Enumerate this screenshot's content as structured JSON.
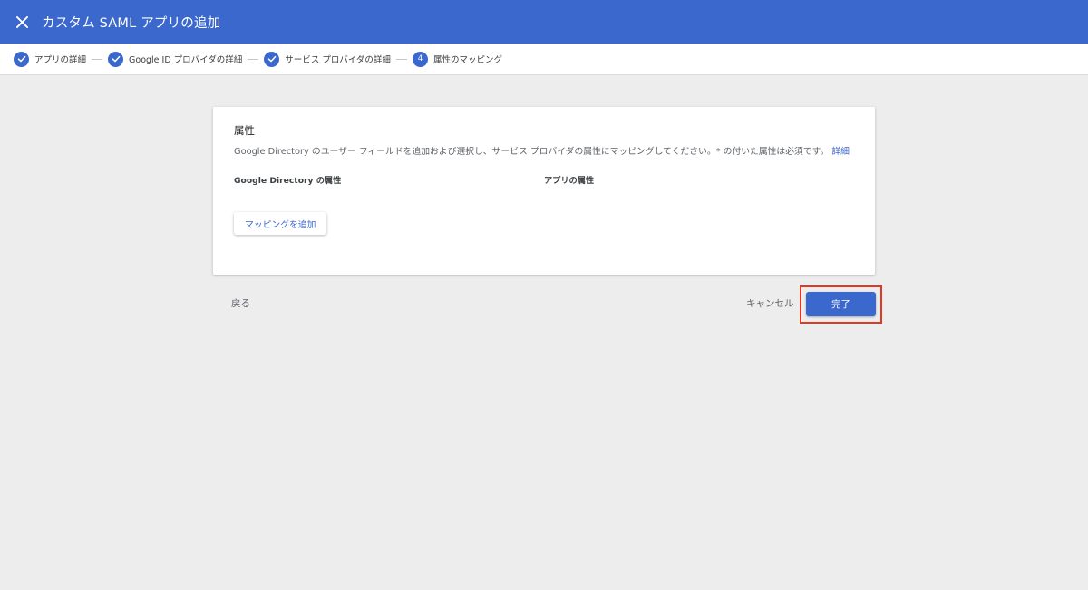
{
  "appbar": {
    "title": "カスタム SAML アプリの追加",
    "close_icon": "close-icon"
  },
  "stepper": {
    "steps": [
      {
        "label": "アプリの詳細",
        "state": "done",
        "icon": "check-icon"
      },
      {
        "label": "Google ID プロバイダの詳細",
        "state": "done",
        "icon": "check-icon"
      },
      {
        "label": "サービス プロバイダの詳細",
        "state": "done",
        "icon": "check-icon"
      },
      {
        "label": "属性のマッピング",
        "state": "current",
        "number": "4"
      }
    ]
  },
  "card": {
    "title": "属性",
    "description": "Google Directory のユーザー フィールドを追加および選択し、サービス プロバイダの属性にマッピングしてください。* の付いた属性は必須です。",
    "learn_more": "詳細",
    "col_directory": "Google Directory の属性",
    "col_app": "アプリの属性",
    "add_mapping_label": "マッピングを追加"
  },
  "footer": {
    "back_label": "戻る",
    "cancel_label": "キャンセル",
    "done_label": "完了"
  },
  "colors": {
    "primary": "#3b68cc",
    "highlight": "#e8371f",
    "background": "#ededed"
  }
}
